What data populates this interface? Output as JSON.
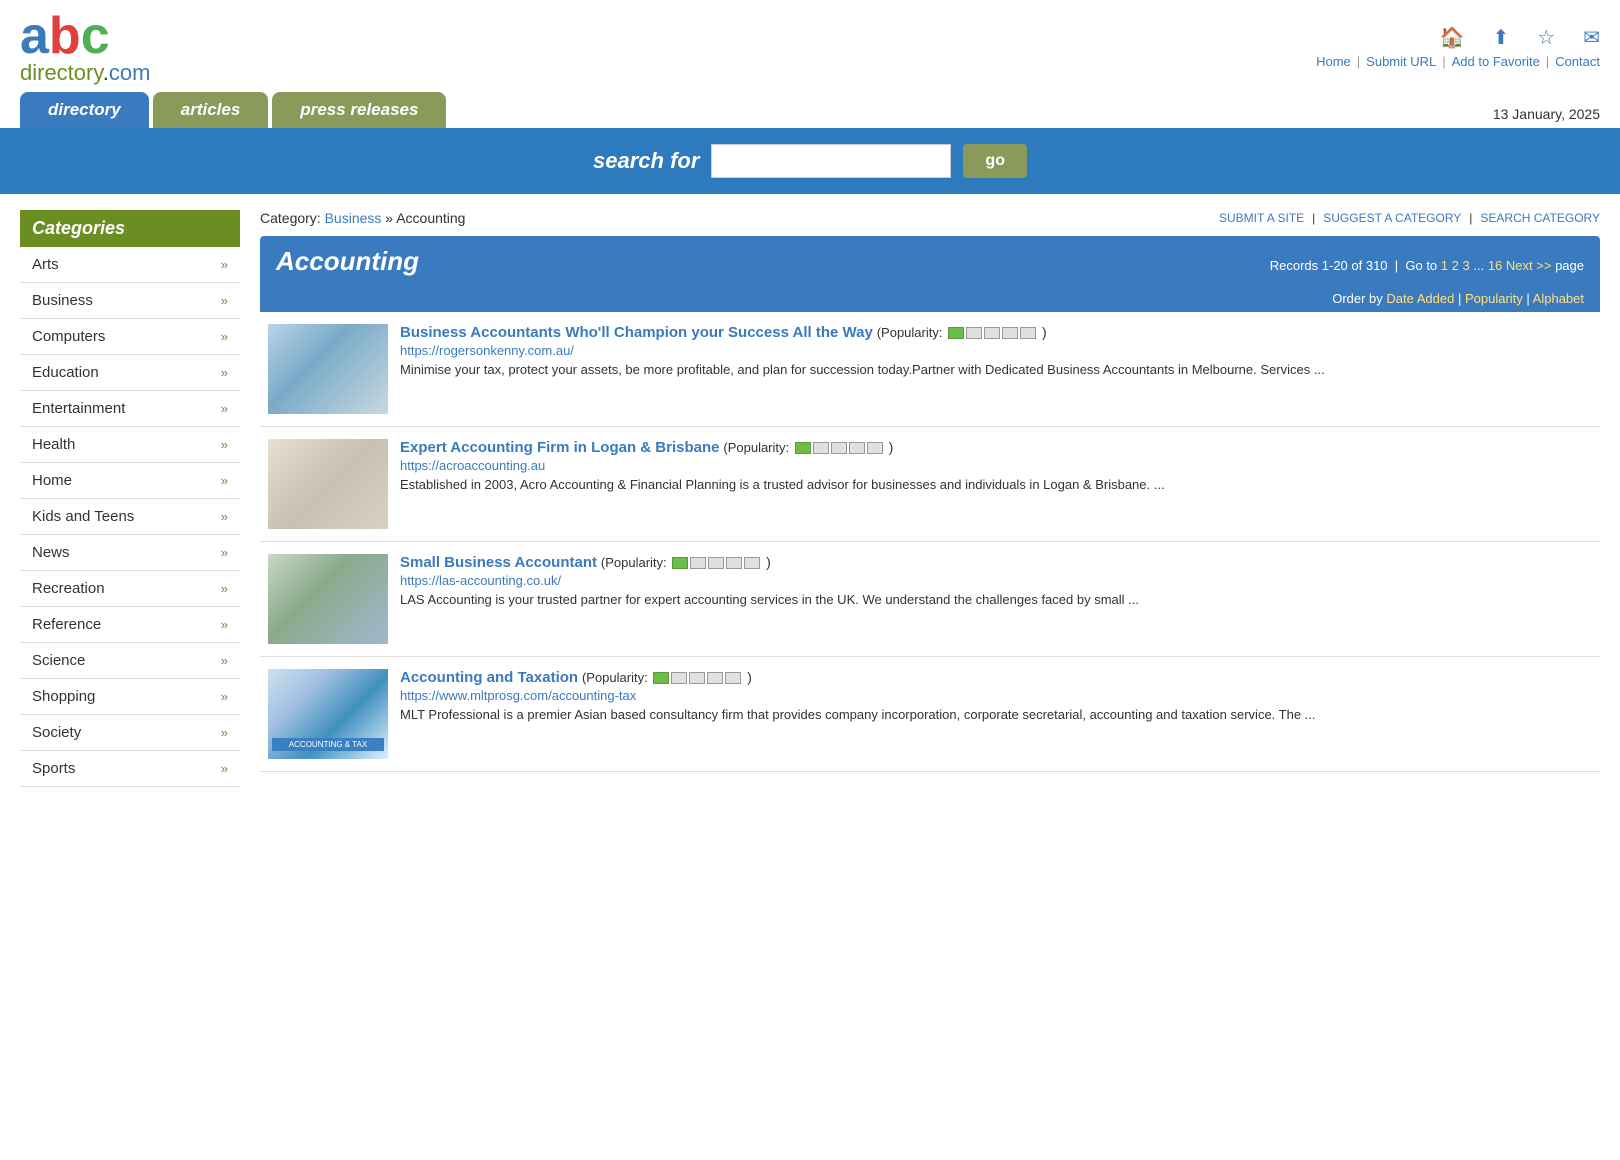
{
  "logo": {
    "abc": "abc",
    "directory": "directory.com"
  },
  "topnav": {
    "home": "Home",
    "submit": "Submit URL",
    "favorite": "Add to Favorite",
    "contact": "Contact"
  },
  "tabs": {
    "directory": "directory",
    "articles": "articles",
    "press_releases": "press releases"
  },
  "date": "13 January, 2025",
  "search": {
    "label": "search for",
    "placeholder": "",
    "go": "go"
  },
  "sidebar": {
    "heading": "Categories",
    "items": [
      {
        "label": "Arts",
        "id": "arts"
      },
      {
        "label": "Business",
        "id": "business"
      },
      {
        "label": "Computers",
        "id": "computers"
      },
      {
        "label": "Education",
        "id": "education"
      },
      {
        "label": "Entertainment",
        "id": "entertainment"
      },
      {
        "label": "Health",
        "id": "health"
      },
      {
        "label": "Home",
        "id": "home"
      },
      {
        "label": "Kids and Teens",
        "id": "kids-and-teens"
      },
      {
        "label": "News",
        "id": "news"
      },
      {
        "label": "Recreation",
        "id": "recreation"
      },
      {
        "label": "Reference",
        "id": "reference"
      },
      {
        "label": "Science",
        "id": "science"
      },
      {
        "label": "Shopping",
        "id": "shopping"
      },
      {
        "label": "Society",
        "id": "society"
      },
      {
        "label": "Sports",
        "id": "sports"
      }
    ]
  },
  "breadcrumb": {
    "category_label": "Category:",
    "parent": "Business",
    "current": "» Accounting",
    "actions": [
      {
        "label": "SUBMIT A SITE",
        "id": "submit-site"
      },
      {
        "label": "SUGGEST A CATEGORY",
        "id": "suggest-cat"
      },
      {
        "label": "SEARCH CATEGORY",
        "id": "search-cat"
      }
    ]
  },
  "category": {
    "title": "Accounting",
    "records": "Records 1-20 of 310",
    "goto_label": "Go to",
    "pages": [
      "1",
      "2",
      "3",
      "...",
      "16"
    ],
    "next": "Next >>",
    "page_suffix": "page",
    "order_label": "Order by",
    "order_options": [
      "Date Added",
      "Popularity",
      "Alphabet"
    ]
  },
  "listings": [
    {
      "title": "Business Accountants Who'll Champion your Success All the Way",
      "url": "https://rogersonkenny.com.au/",
      "popularity": 1,
      "max_popularity": 5,
      "description": "Minimise your tax, protect your assets, be more profitable, and plan for succession today.Partner with Dedicated Business Accountants in Melbourne. Services ..."
    },
    {
      "title": "Expert Accounting Firm in Logan & Brisbane",
      "url": "https://acroaccounting.au",
      "popularity": 1,
      "max_popularity": 5,
      "description": "Established in 2003, Acro Accounting & Financial Planning is a trusted advisor for businesses and individuals in Logan & Brisbane. ..."
    },
    {
      "title": "Small Business Accountant",
      "url": "https://las-accounting.co.uk/",
      "popularity": 1,
      "max_popularity": 5,
      "description": "LAS Accounting is your trusted partner for expert accounting services in the UK. We understand the challenges faced by small ..."
    },
    {
      "title": "Accounting and Taxation",
      "url": "https://www.mltprosg.com/accounting-tax",
      "popularity": 1,
      "max_popularity": 5,
      "description": "MLT Professional is a premier Asian based consultancy firm that provides company incorporation, corporate secretarial, accounting and taxation service. The ..."
    }
  ]
}
